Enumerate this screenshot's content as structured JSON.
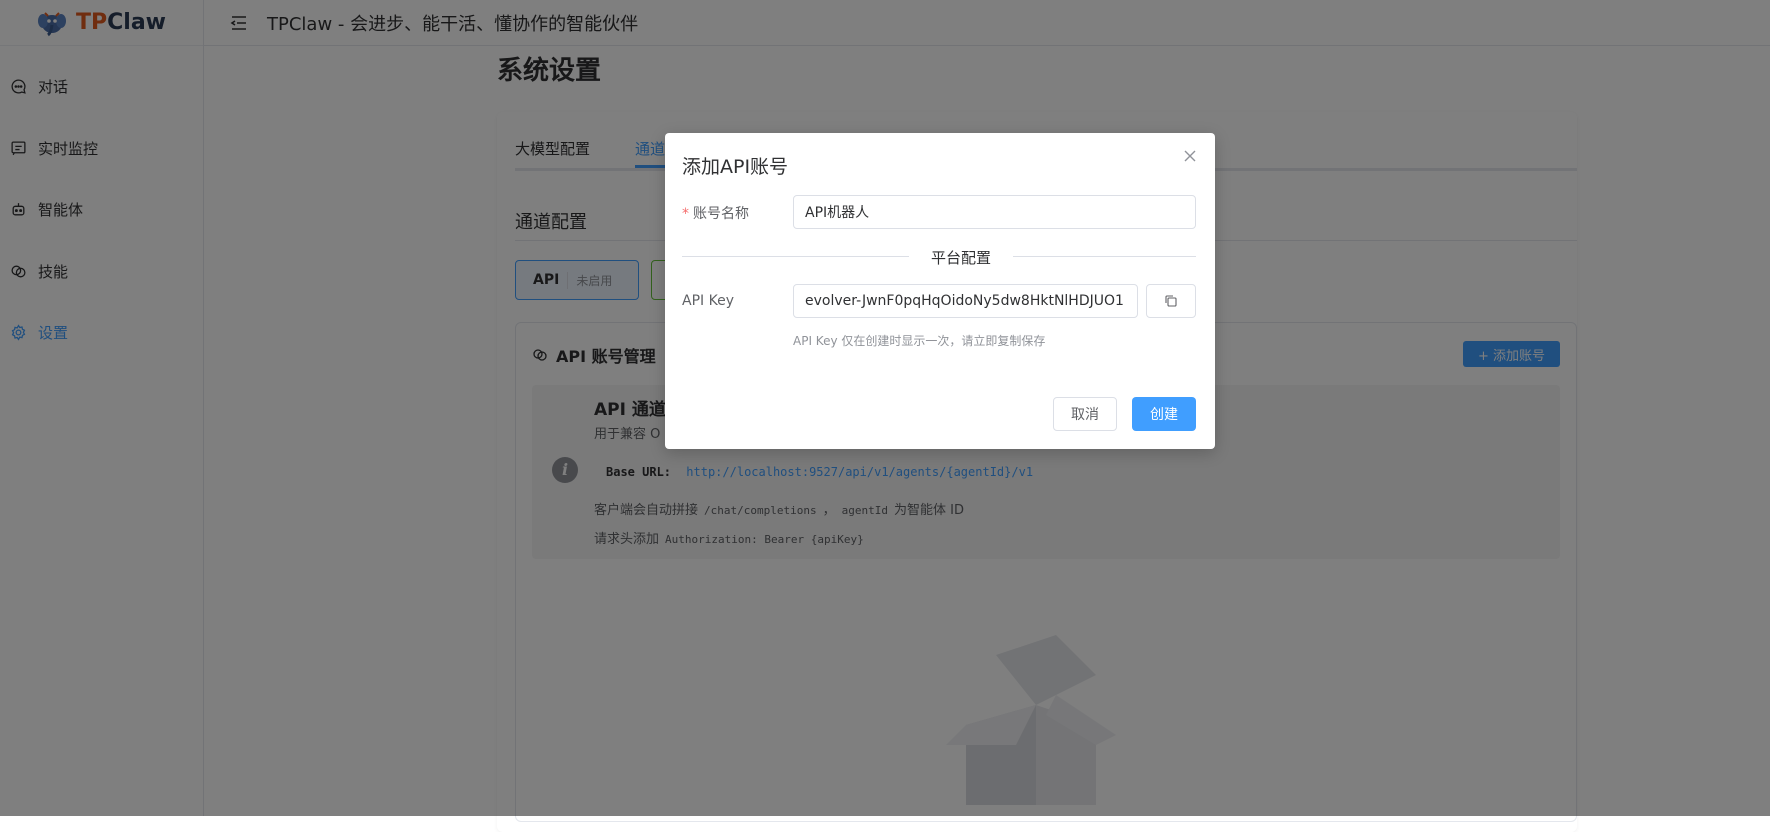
{
  "brand": {
    "tp": "TP",
    "claw": "Claw"
  },
  "topbar": {
    "title": "TPClaw - 会进步、能干活、懂协作的智能伙伴"
  },
  "sidebar": {
    "items": [
      {
        "label": "对话",
        "icon": "chat-icon"
      },
      {
        "label": "实时监控",
        "icon": "monitor-icon"
      },
      {
        "label": "智能体",
        "icon": "robot-icon"
      },
      {
        "label": "技能",
        "icon": "skill-icon"
      },
      {
        "label": "设置",
        "icon": "gear-icon",
        "active": true
      }
    ]
  },
  "page": {
    "title": "系统设置",
    "tabs": [
      {
        "label": "大模型配置"
      },
      {
        "label": "通道",
        "active": true
      }
    ],
    "section_title": "通道配置",
    "channel": {
      "name": "API",
      "status": "未启用"
    },
    "account_panel": {
      "title": "API 账号管理",
      "add_button": "+ 添加账号",
      "info_heading": "API 通道",
      "info_desc": "用于兼容 O",
      "base_url_label": "Base URL:",
      "base_url": "http://localhost:9527/api/v1/agents/{agentId}/v1",
      "line1_prefix": "客户端会自动拼接",
      "line1_code1": "/chat/completions",
      "line1_sep": "，",
      "line1_code2": "agentId",
      "line1_suffix": "为智能体 ID",
      "line2_prefix": "请求头添加",
      "line2_code": "Authorization: Bearer {apiKey}"
    }
  },
  "dialog": {
    "title": "添加API账号",
    "name_label": "账号名称",
    "name_value": "API机器人",
    "divider": "平台配置",
    "apikey_label": "API Key",
    "apikey_value": "evolver-JwnF0pqHqOidoNy5dw8HktNlHDJUO1",
    "hint": "API Key 仅在创建时显示一次，请立即复制保存",
    "cancel": "取消",
    "create": "创建"
  },
  "colors": {
    "primary": "#409eff",
    "brand_orange": "#e05a1f",
    "brand_dark": "#2b3a55"
  }
}
